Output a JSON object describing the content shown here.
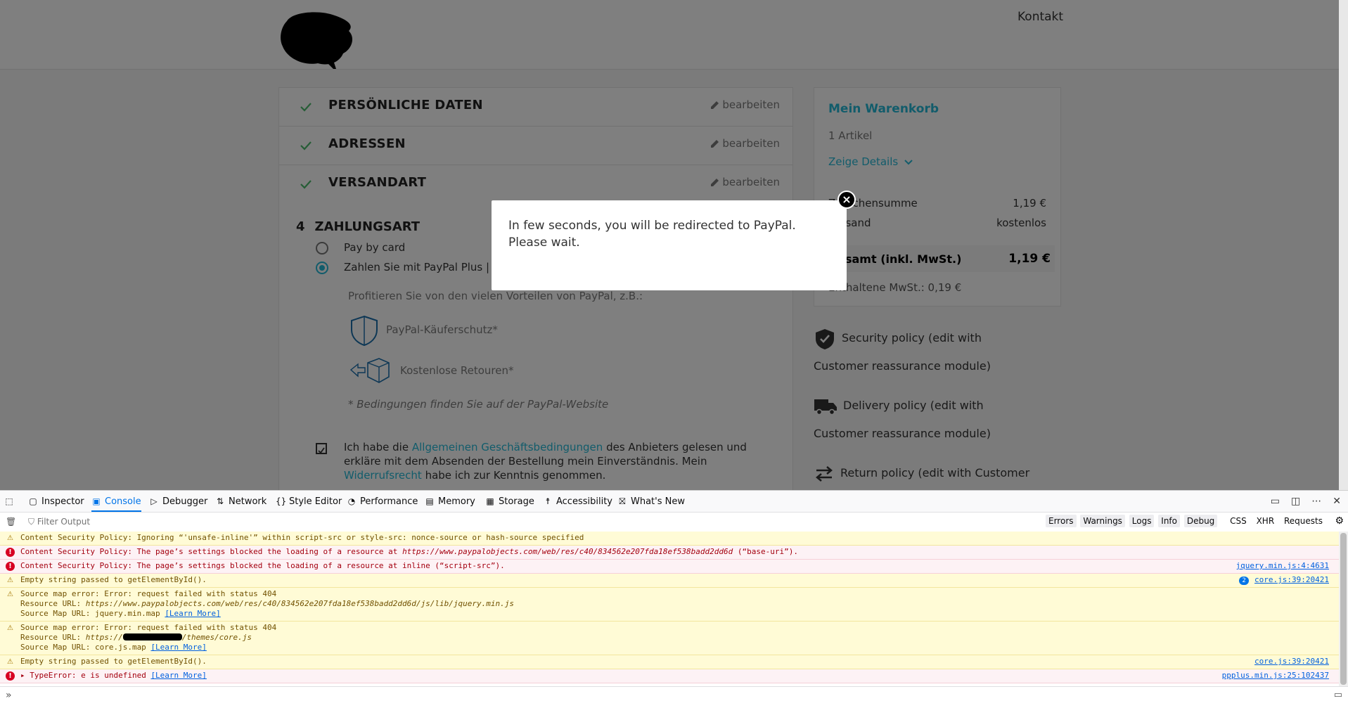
{
  "header": {
    "contact_link": "Kontakt"
  },
  "checkout": {
    "steps": [
      {
        "title": "PERSÖNLICHE DATEN",
        "edit": "bearbeiten"
      },
      {
        "title": "ADRESSEN",
        "edit": "bearbeiten"
      },
      {
        "title": "VERSANDART",
        "edit": "bearbeiten"
      }
    ],
    "payment": {
      "number": "4",
      "title": "ZAHLUNGSART",
      "option_card": "Pay by card",
      "option_paypal": "Zahlen Sie mit PayPal Plus | Es",
      "benefits_intro": "Profitieren Sie von den vielen Vorteilen von PayPal, z.B.:",
      "benefit_1": "PayPal-Käuferschutz*",
      "benefit_2": "Kostenlose Retouren*",
      "conditions_note": "* Bedingungen finden Sie auf der PayPal-Website",
      "terms_pre": "Ich habe die ",
      "terms_link": "Allgemeinen Geschäftsbedingungen",
      "terms_mid": " des Anbieters gelesen und erkläre mit dem Absenden der Bestellung mein Einverständnis. Mein ",
      "withdrawal_link": "Widerrufsrecht",
      "terms_post": " habe ich zur Kenntnis genommen."
    }
  },
  "cart": {
    "title": "Mein Warenkorb",
    "count": "1 Artikel",
    "details": "Zeige Details",
    "subtotal_label": "Zwischensumme",
    "subtotal_value": "1,19 €",
    "shipping_label": "Versand",
    "shipping_value": "kostenlos",
    "total_label": "Gesamt (inkl. MwSt.)",
    "total_value": "1,19 €",
    "tax_line": "Enthaltene MwSt.: 0,19 €"
  },
  "reassurance": [
    "Security policy (edit with Customer reassurance module)",
    "Delivery policy (edit with Customer reassurance module)",
    "Return policy (edit with Customer"
  ],
  "modal": {
    "message": "In few seconds, you will be redirected to PayPal. Please wait.",
    "close": "×"
  },
  "devtools": {
    "tabs": [
      "Inspector",
      "Console",
      "Debugger",
      "Network",
      "Style Editor",
      "Performance",
      "Memory",
      "Storage",
      "Accessibility",
      "What's New"
    ],
    "filter_placeholder": "Filter Output",
    "filter_buttons": [
      "Errors",
      "Warnings",
      "Logs",
      "Info",
      "Debug",
      "CSS",
      "XHR",
      "Requests"
    ],
    "messages": [
      {
        "level": "warn",
        "text": "Content Security Policy: Ignoring “'unsafe-inline'” within script-src or style-src: nonce-source or hash-source specified",
        "source": ""
      },
      {
        "level": "err",
        "text": "Content Security Policy: The page’s settings blocked the loading of a resource at ",
        "url": "https://www.paypalobjects.com/web/res/c40/834562e207fda18ef538badd2dd6d",
        "text_after": " (“base-uri”).",
        "source": ""
      },
      {
        "level": "err",
        "text": "Content Security Policy: The page’s settings blocked the loading of a resource at inline (“script-src”).",
        "source": "jquery.min.js:4:4631"
      },
      {
        "level": "warn",
        "text": "Empty string passed to getElementById().",
        "source": "core.js:39:20421",
        "badge": "2"
      },
      {
        "level": "warn",
        "line1": "Source map error: Error: request failed with status 404",
        "line2_label": "Resource URL: ",
        "line2_url": "https://www.paypalobjects.com/web/res/c40/834562e207fda18ef538badd2dd6d/js/lib/jquery.min.js",
        "line3": "Source Map URL: jquery.min.map ",
        "learn": "[Learn More]"
      },
      {
        "level": "warn",
        "line1": "Source map error: Error: request failed with status 404",
        "line2_label": "Resource URL: ",
        "line2_url_a": "https://",
        "line2_url_b": "/themes/core.js",
        "line3": "Source Map URL: core.js.map ",
        "learn": "[Learn More]"
      },
      {
        "level": "warn",
        "text": "Empty string passed to getElementById().",
        "source": "core.js:39:20421"
      },
      {
        "level": "err",
        "text": "TypeError: e is undefined ",
        "learn": "[Learn More]",
        "source": "ppplus.min.js:25:102437"
      }
    ]
  }
}
